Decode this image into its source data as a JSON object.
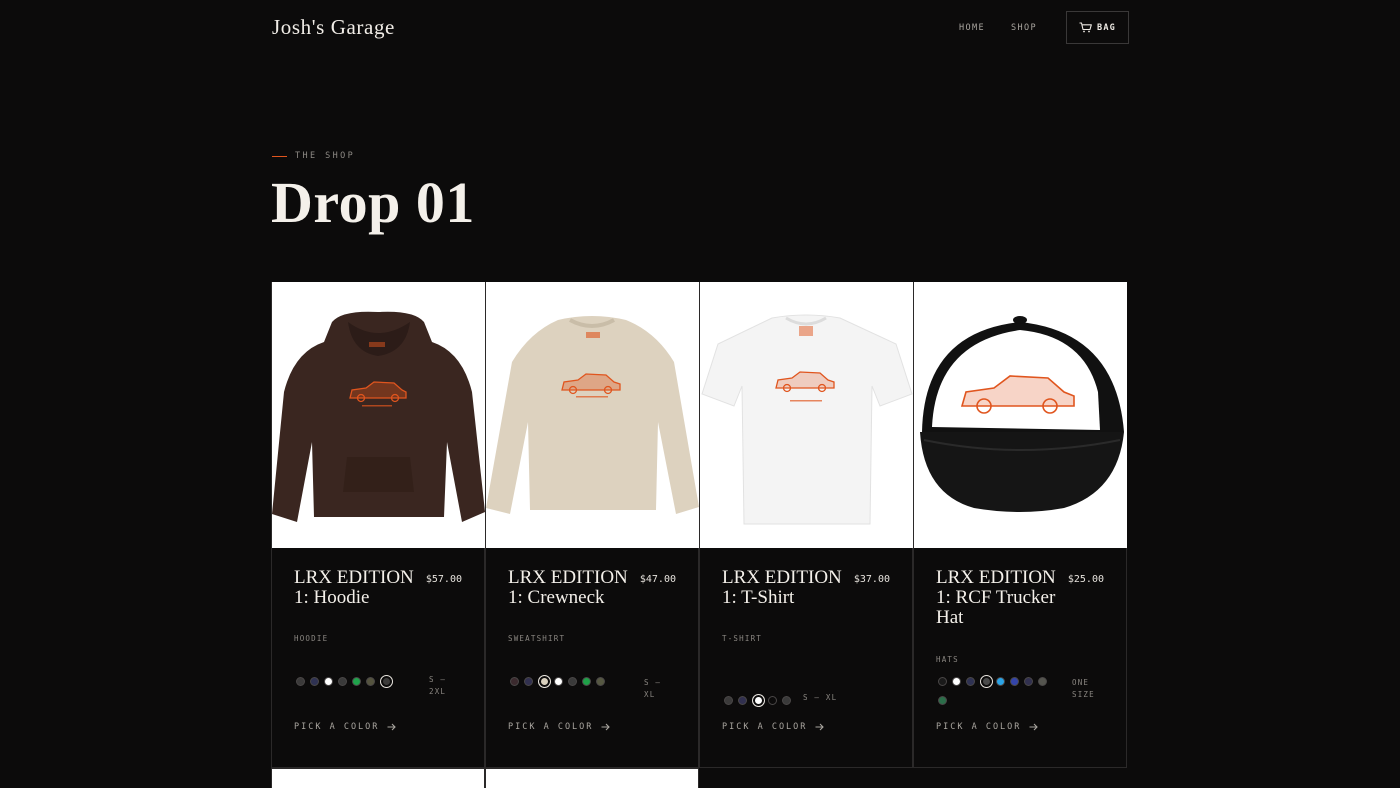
{
  "header": {
    "brand": "Josh's Garage",
    "nav": [
      {
        "label": "HOME"
      },
      {
        "label": "SHOP"
      }
    ],
    "bag": {
      "label": "BAG",
      "icon": "cart-icon"
    }
  },
  "hero": {
    "eyebrow": "THE SHOP",
    "title": "Drop 01"
  },
  "colors": {
    "background": "#0c0b0b",
    "accent": "#e0551e",
    "text": "#f4f0ea"
  },
  "products": [
    {
      "name": "LRX EDITION 1: Hoodie",
      "price": "$57.00",
      "category": "HOODIE",
      "image": "brown-hoodie",
      "swatches": [
        "#3b3a3a",
        "#2f3253",
        "#ffffff",
        "#3a3a3a",
        "#20a34c",
        "#55543f",
        "#3c3b3a"
      ],
      "selected_swatch": 7,
      "sizes": "S – 2XL",
      "cta": "PICK A COLOR"
    },
    {
      "name": "LRX EDITION 1: Crewneck",
      "price": "$47.00",
      "category": "SWEATSHIRT",
      "image": "sand-crewneck",
      "swatches": [
        "#3b2a2e",
        "#31304f",
        "#d9d0be",
        "#ffffff",
        "#3a3a3a",
        "#1fa048",
        "#565842"
      ],
      "selected_swatch": 3,
      "sizes": "S – XL",
      "cta": "PICK A COLOR"
    },
    {
      "name": "LRX EDITION 1: T-Shirt",
      "price": "$37.00",
      "category": "T-SHIRT",
      "image": "white-tshirt",
      "swatches": [
        "#3b3a3a",
        "#31304f",
        "#ffffff",
        "#0c0b0b",
        "#3a3a3a"
      ],
      "selected_swatch": 3,
      "sizes": "S – XL",
      "cta": "PICK A COLOR"
    },
    {
      "name": "LRX EDITION 1: RCF Trucker Hat",
      "price": "$25.00",
      "category": "HATS",
      "image": "trucker-hat",
      "swatches": [
        "#1a1a1a",
        "#ffffff",
        "#2f3253",
        "#4a4a4a",
        "#2aa3e6",
        "#3344aa",
        "#31304f",
        "#55554f",
        "#2c6e4a"
      ],
      "selected_swatch": 4,
      "sizes": "ONE SIZE",
      "cta": "PICK A COLOR"
    }
  ]
}
